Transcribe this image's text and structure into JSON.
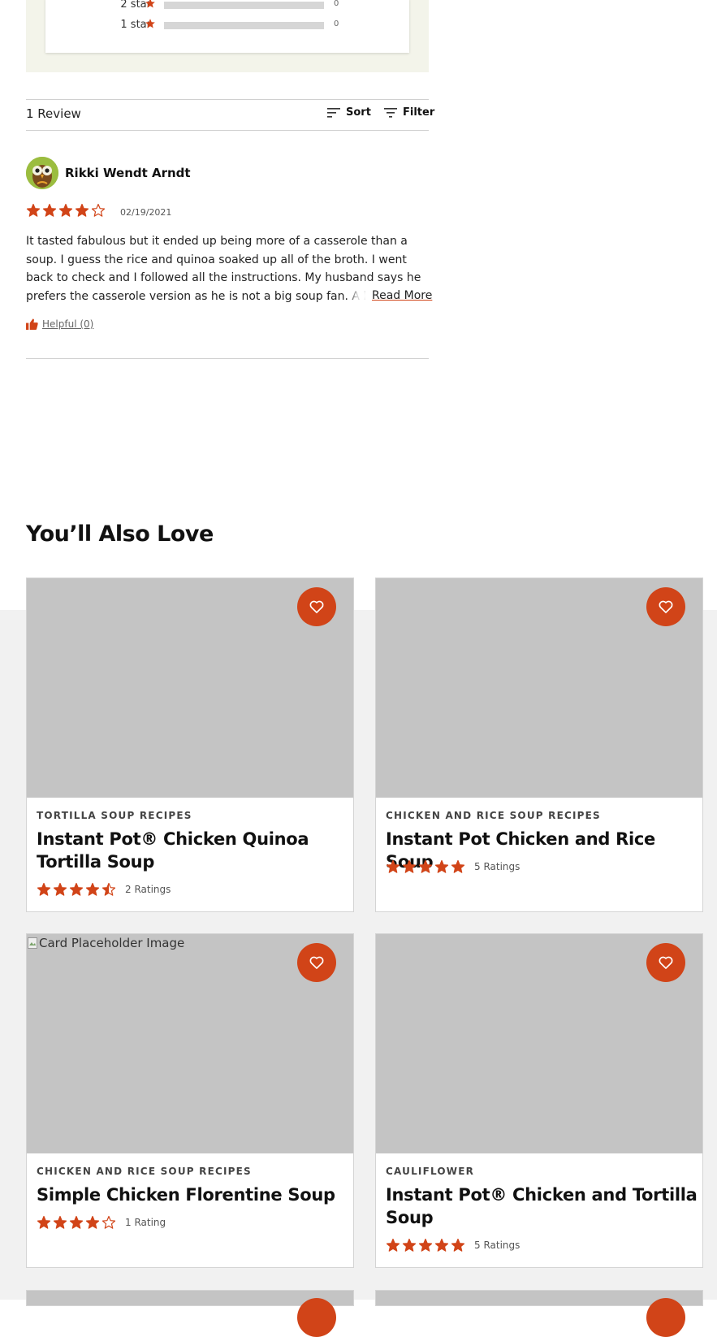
{
  "breakdown": {
    "rows": [
      {
        "label": "2 star",
        "count": "0",
        "fraction": 0
      },
      {
        "label": "1 star",
        "count": "0",
        "fraction": 0
      }
    ]
  },
  "reviews": {
    "count_label": "1 Review",
    "sort_label": "Sort",
    "filter_label": "Filter"
  },
  "review": {
    "author": "Rikki Wendt Arndt",
    "rating": 4,
    "max_rating": 5,
    "date": "02/19/2021",
    "text": "It tasted fabulous but it ended up being more of a casserole than a soup. I guess the rice and quinoa soaked up all of the broth. I went back to check and I followed all the instructions. My husband says he prefers the casserole version as he is not a big soup fan. A big plus was that",
    "read_more": "Read More",
    "helpful": "Helpful (0)"
  },
  "also_love": {
    "title": "You’ll Also Love",
    "cards": [
      {
        "category": "TORTILLA SOUP RECIPES",
        "title": "Instant Pot® Chicken Quinoa Tortilla Soup",
        "rating": 4.5,
        "ratings_label": "2 Ratings",
        "image_alt": ""
      },
      {
        "category": "CHICKEN AND RICE SOUP RECIPES",
        "title": "Instant Pot Chicken and Rice Soup",
        "rating": 5,
        "ratings_label": "5 Ratings",
        "image_alt": ""
      },
      {
        "category": "CHICKEN AND RICE SOUP RECIPES",
        "title": "Simple Chicken Florentine Soup",
        "rating": 4,
        "ratings_label": "1 Rating",
        "image_alt": "Card Placeholder Image"
      },
      {
        "category": "CAULIFLOWER",
        "title": "Instant Pot® Chicken and Tortilla Soup",
        "rating": 5,
        "ratings_label": "5 Ratings",
        "image_alt": ""
      }
    ]
  },
  "colors": {
    "accent": "#d14418",
    "page_band": "#f1f1f1",
    "breakdown_bg": "#f3f4ea",
    "image_placeholder": "#c4c4c4"
  },
  "icons": {
    "sort": "sort-icon",
    "filter": "filter-icon",
    "star": "star-icon",
    "helpful": "thumbs-up-icon",
    "favorite": "heart-icon"
  }
}
